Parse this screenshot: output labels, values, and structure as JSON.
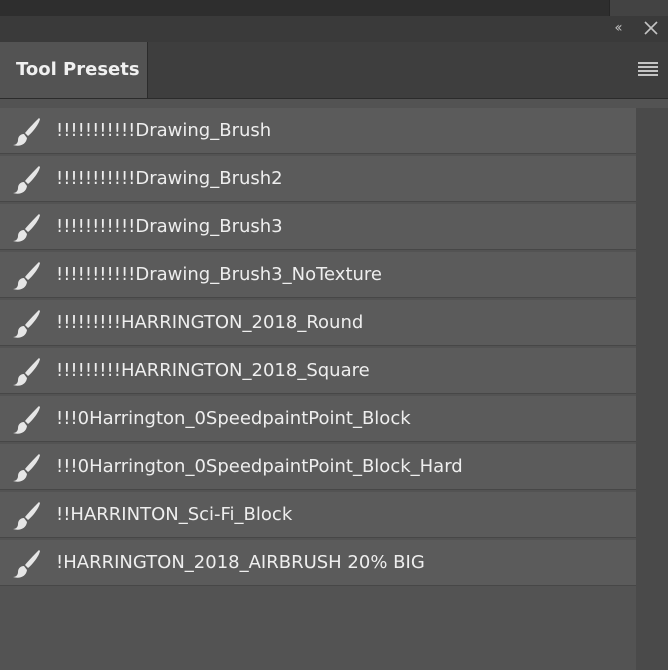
{
  "panel": {
    "tab_title": "Tool Presets",
    "collapse_glyph": "‹‹",
    "collapse_icon": "double-chevron-left-icon",
    "close_icon": "close-icon",
    "menu_icon": "panel-menu-icon"
  },
  "presets": [
    {
      "label": "!!!!!!!!!!!Drawing_Brush",
      "icon": "brush-icon"
    },
    {
      "label": "!!!!!!!!!!!Drawing_Brush2",
      "icon": "brush-icon"
    },
    {
      "label": "!!!!!!!!!!!Drawing_Brush3",
      "icon": "brush-icon"
    },
    {
      "label": "!!!!!!!!!!!Drawing_Brush3_NoTexture",
      "icon": "brush-icon"
    },
    {
      "label": "!!!!!!!!!HARRINGTON_2018_Round",
      "icon": "brush-icon"
    },
    {
      "label": "!!!!!!!!!HARRINGTON_2018_Square",
      "icon": "brush-icon"
    },
    {
      "label": "!!!0Harrington_0SpeedpaintPoint_Block",
      "icon": "brush-icon"
    },
    {
      "label": "!!!0Harrington_0SpeedpaintPoint_Block_Hard",
      "icon": "brush-icon"
    },
    {
      "label": "!!HARRINTON_Sci-Fi_Block",
      "icon": "brush-icon"
    },
    {
      "label": "!HARRINGTON_2018_AIRBRUSH 20% BIG",
      "icon": "brush-icon"
    }
  ]
}
